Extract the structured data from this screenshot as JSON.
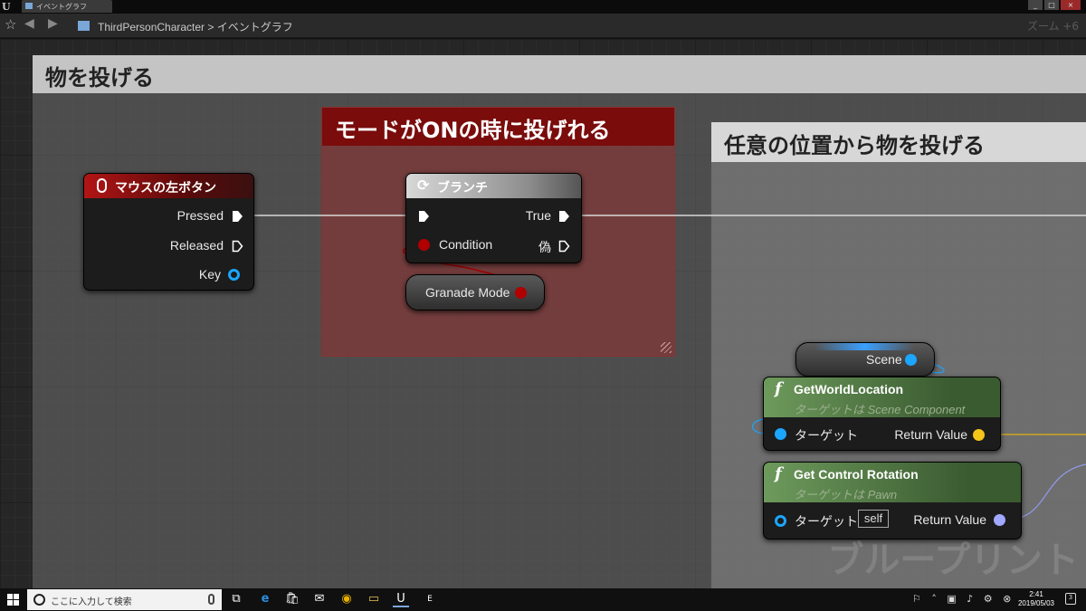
{
  "window": {
    "tab_title": "イベントグラフ",
    "buttons": [
      "_",
      "□",
      "×"
    ]
  },
  "toolbar": {
    "breadcrumb": "ThirdPersonCharacter > イベントグラフ",
    "zoom": "ズーム +6"
  },
  "comments": {
    "outer": "物を投げる",
    "mode": "モードがONの時に投げれる",
    "position": "任意の位置から物を投げる"
  },
  "nodes": {
    "mouse": {
      "title": "マウスの左ボタン",
      "pins": [
        "Pressed",
        "Released",
        "Key"
      ]
    },
    "branch": {
      "title": "ブランチ",
      "pin_true": "True",
      "pin_condition": "Condition",
      "pin_false": "偽"
    },
    "granade_mode": "Granade Mode",
    "scene": "Scene",
    "get_world_location": {
      "title": "GetWorldLocation",
      "subtitle": "ターゲットは Scene Component",
      "pin_target": "ターゲット",
      "pin_return": "Return Value"
    },
    "get_control_rotation": {
      "title": "Get Control Rotation",
      "subtitle": "ターゲットは Pawn",
      "pin_target": "ターゲット",
      "self_value": "self",
      "pin_return": "Return Value"
    }
  },
  "watermark": "ブループリント",
  "colors": {
    "exec_wire": "#ffffff",
    "bool_pin": "#b00000",
    "object_pin": "#1ba6ff",
    "vector_pin": "#f5c518",
    "rotator_pin": "#a0a8ff"
  },
  "taskbar": {
    "search_placeholder": "ここに入力して検索",
    "time": "2:41",
    "date": "2019/05/03",
    "apps": [
      "task-view",
      "edge",
      "store",
      "mail",
      "chrome",
      "explorer",
      "unreal",
      "epic"
    ]
  }
}
